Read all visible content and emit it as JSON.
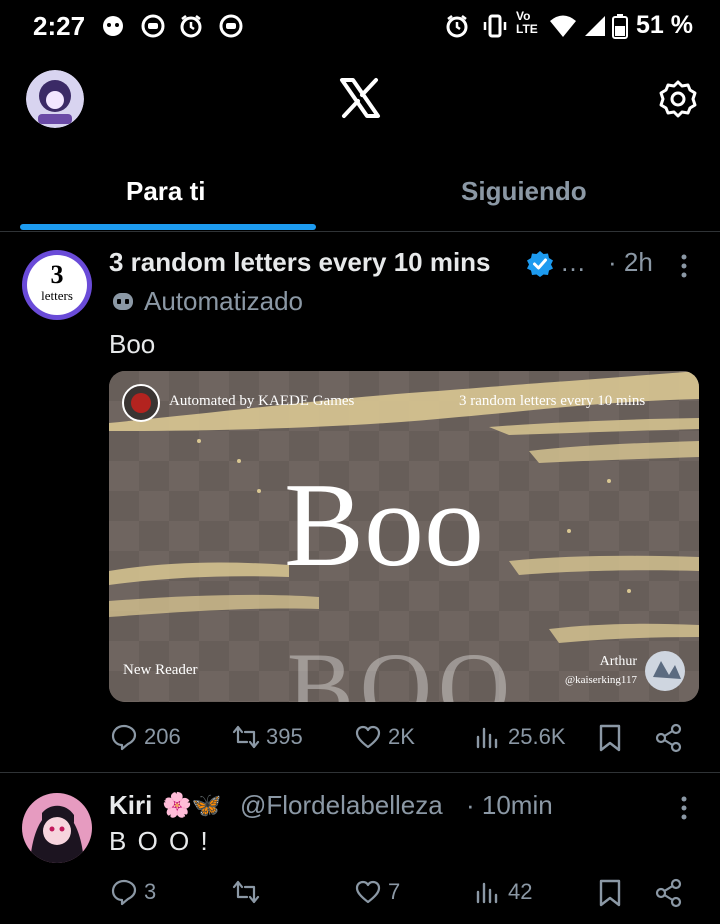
{
  "status_bar": {
    "time": "2:27",
    "battery": "51 %",
    "network": "LTE",
    "volte": "Vo"
  },
  "header": {
    "logo": "x-logo-icon",
    "settings_icon": "gear-icon"
  },
  "tabs": [
    {
      "label": "Para ti",
      "active": true
    },
    {
      "label": "Siguiendo",
      "active": false
    }
  ],
  "tweets": [
    {
      "avatar_text_top": "3",
      "avatar_text_bottom": "letters",
      "name": "3 random letters every 10 mins",
      "verified": true,
      "ellipsis": "…",
      "time": "· 2h",
      "label": "Automatizado",
      "text": "Boo",
      "media": {
        "automated_by": "Automated by KAEDE Games",
        "series": "3 random letters every 10 mins",
        "word": "Boo",
        "reader_label": "New Reader",
        "author_name": "Arthur",
        "author_handle": "@kaiserking117"
      },
      "replies": "206",
      "reposts": "395",
      "likes": "2K",
      "views": "25.6K"
    },
    {
      "name": "Kiri",
      "emoji": "🌸🦋",
      "handle": "@Flordelabelleza",
      "time": "· 10min",
      "text": "B O O !",
      "replies": "3",
      "reposts": "",
      "likes": "7",
      "views": "42"
    }
  ]
}
